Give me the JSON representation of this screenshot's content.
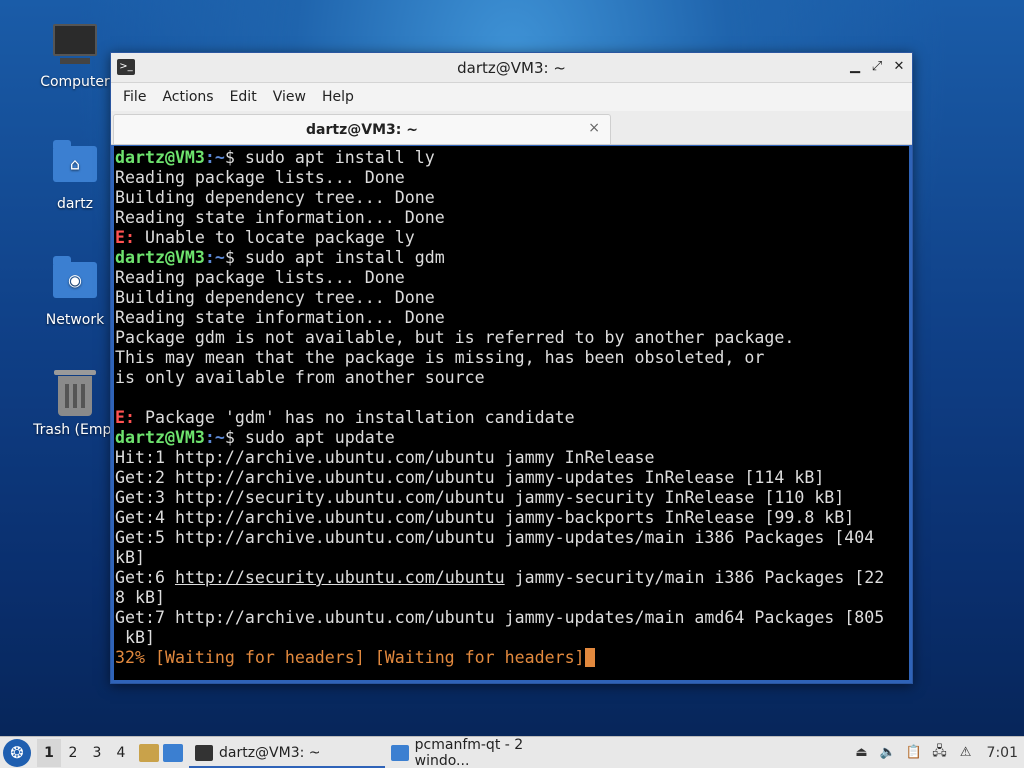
{
  "desktop": {
    "icons": [
      {
        "label": "Computer"
      },
      {
        "label": "dartz"
      },
      {
        "label": "Network"
      },
      {
        "label": "Trash (Empt"
      }
    ]
  },
  "window": {
    "title": "dartz@VM3: ~",
    "menu": [
      "File",
      "Actions",
      "Edit",
      "View",
      "Help"
    ],
    "tab_label": "dartz@VM3: ~",
    "tab_close": "×"
  },
  "terminal": {
    "prompt_user": "dartz@VM3",
    "prompt_path": ":~",
    "lines": [
      {
        "type": "cmd",
        "text": "$ sudo apt install ly"
      },
      {
        "type": "out",
        "text": "Reading package lists... Done"
      },
      {
        "type": "out",
        "text": "Building dependency tree... Done"
      },
      {
        "type": "out",
        "text": "Reading state information... Done"
      },
      {
        "type": "err",
        "tag": "E:",
        "text": " Unable to locate package ly"
      },
      {
        "type": "cmd",
        "text": "$ sudo apt install gdm"
      },
      {
        "type": "out",
        "text": "Reading package lists... Done"
      },
      {
        "type": "out",
        "text": "Building dependency tree... Done"
      },
      {
        "type": "out",
        "text": "Reading state information... Done"
      },
      {
        "type": "out",
        "text": "Package gdm is not available, but is referred to by another package."
      },
      {
        "type": "out",
        "text": "This may mean that the package is missing, has been obsoleted, or"
      },
      {
        "type": "out",
        "text": "is only available from another source"
      },
      {
        "type": "out",
        "text": ""
      },
      {
        "type": "err",
        "tag": "E:",
        "text": " Package 'gdm' has no installation candidate"
      },
      {
        "type": "cmd",
        "text": "$ sudo apt update"
      },
      {
        "type": "out",
        "text": "Hit:1 http://archive.ubuntu.com/ubuntu jammy InRelease"
      },
      {
        "type": "out",
        "text": "Get:2 http://archive.ubuntu.com/ubuntu jammy-updates InRelease [114 kB]"
      },
      {
        "type": "out",
        "text": "Get:3 http://security.ubuntu.com/ubuntu jammy-security InRelease [110 kB]"
      },
      {
        "type": "out",
        "text": "Get:4 http://archive.ubuntu.com/ubuntu jammy-backports InRelease [99.8 kB]"
      },
      {
        "type": "out",
        "text": "Get:5 http://archive.ubuntu.com/ubuntu jammy-updates/main i386 Packages [404"
      },
      {
        "type": "out",
        "text": "kB]"
      },
      {
        "type": "link",
        "pre": "Get:6 ",
        "link": "http://security.ubuntu.com/ubuntu",
        "post": " jammy-security/main i386 Packages [22"
      },
      {
        "type": "out",
        "text": "8 kB]"
      },
      {
        "type": "out",
        "text": "Get:7 http://archive.ubuntu.com/ubuntu jammy-updates/main amd64 Packages [805"
      },
      {
        "type": "out",
        "text": " kB]"
      },
      {
        "type": "prog",
        "text": "32% [Waiting for headers] [Waiting for headers]"
      }
    ]
  },
  "taskbar": {
    "workspaces": [
      "1",
      "2",
      "3",
      "4"
    ],
    "tasks": [
      {
        "label": "dartz@VM3: ~"
      },
      {
        "label": "pcmanfm-qt - 2 windo..."
      }
    ],
    "clock": "7:01"
  }
}
